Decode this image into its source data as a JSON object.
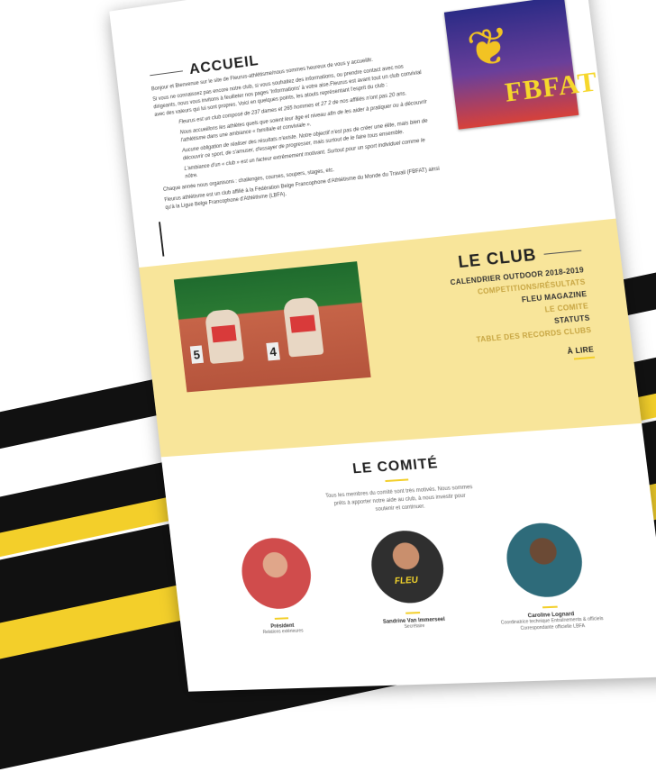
{
  "accueil": {
    "title": "ACCUEIL",
    "p1": "Bonjour et Bienvenue sur le site de Fleurus-athlétisme/nous sommes heureux de vous y accueillir.",
    "p2": "Si vous ne connaissez pas encore notre club, si vous souhaitez des informations, ou prendre contact avec nos dirigeants, nous vous invitons à feuilleter nos pages 'Informations' à votre aise.Fleurus est avant tout un club convivial avec des valeurs qui lui sont propres. Voici en quelques points, les atouts représentant l'esprit du club :",
    "p3": "Fleurus est un club composé de 237 dames et 265 hommes et 27 2 de nos affiliés n'ont pas 20 ans.",
    "p4": "Nous accueillons les athlètes quels que soient leur âge et niveau afin de les aider à pratiquer ou à découvrir l'athlétisme dans une ambiance « familiale et conviviale ».",
    "p5": "Aucune obligation de réaliser des résultats n'existe. Notre objectif n'est pas de créer une élite, mais bien de découvrir ce sport, de s'amuser, d'essayer de progresser, mais surtout de le faire tous ensemble.",
    "p6": "L'ambiance d'un « club » est un facteur extrêmement motivant. Surtout pour un sport individuel comme le nôtre.",
    "p7": "Chaque année nous organisons : challenges, courses, soupers, stages, etc.",
    "p8": "Fleurus athlétisme est un club affilié à la Fédération Belge Francophone d'Athlétisme du Monde du Travail (FBFAT) ainsi qu'à la Ligue Belge Francophone d'Athlétisme (LBFA)."
  },
  "logo": {
    "text": "FBFAT"
  },
  "watermark": "LE CLUB",
  "club": {
    "title": "LE CLUB",
    "items": [
      "CALENDRIER OUTDOOR 2018-2019",
      "COMPETITIONS/RÉSULTATS",
      "FLEU MAGAZINE",
      "LE COMITE",
      "STATUTS",
      "TABLE DES RECORDS CLUBS"
    ],
    "more": "À LIRE",
    "lanes": [
      "5",
      "4"
    ]
  },
  "comite": {
    "title": "LE COMITÉ",
    "intro": "Tous les membres du comité sont très motivés. Nous sommes prêts à apporter notre aide au club, à nous investir pour soutenir et continuer.",
    "members": [
      {
        "name": "Président",
        "role": "Relations extérieures",
        "shirt": ""
      },
      {
        "name": "Sandrine Van Immerseel",
        "role": "Secrétaire",
        "shirt": "FLEU"
      },
      {
        "name": "Caroline Lognard",
        "role": "Coordinatrice technique Entraînements & officiels Correspondante officielle LBFA",
        "shirt": ""
      }
    ]
  }
}
